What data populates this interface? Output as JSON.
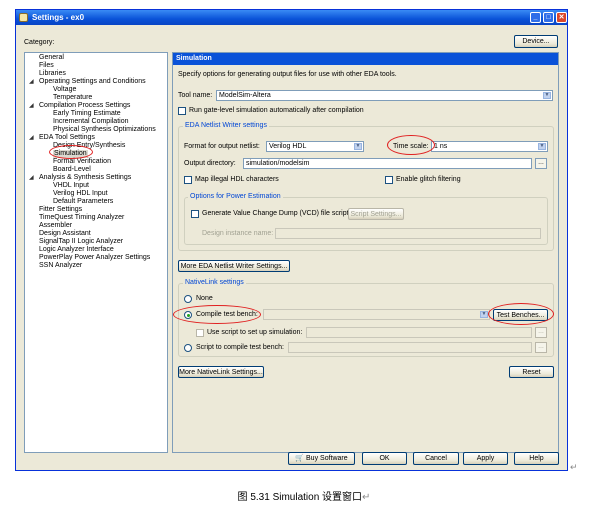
{
  "window": {
    "title": "Settings - ex0"
  },
  "category_label": "Category:",
  "device_button": "Device...",
  "tree": [
    {
      "label": "General"
    },
    {
      "label": "Files"
    },
    {
      "label": "Libraries"
    },
    {
      "label": "Operating Settings and Conditions",
      "expanded": true
    },
    {
      "label": "Voltage"
    },
    {
      "label": "Temperature"
    },
    {
      "label": "Compilation Process Settings",
      "expanded": true
    },
    {
      "label": "Early Timing Estimate"
    },
    {
      "label": "Incremental Compilation"
    },
    {
      "label": "Physical Synthesis Optimizations"
    },
    {
      "label": "EDA Tool Settings",
      "expanded": true
    },
    {
      "label": "Design Entry/Synthesis"
    },
    {
      "label": "Simulation",
      "selected": true
    },
    {
      "label": "Formal Verification"
    },
    {
      "label": "Board-Level"
    },
    {
      "label": "Analysis & Synthesis Settings",
      "expanded": true
    },
    {
      "label": "VHDL Input"
    },
    {
      "label": "Verilog HDL Input"
    },
    {
      "label": "Default Parameters"
    },
    {
      "label": "Fitter Settings"
    },
    {
      "label": "TimeQuest Timing Analyzer"
    },
    {
      "label": "Assembler"
    },
    {
      "label": "Design Assistant"
    },
    {
      "label": "SignalTap II Logic Analyzer"
    },
    {
      "label": "Logic Analyzer Interface"
    },
    {
      "label": "PowerPlay Power Analyzer Settings"
    },
    {
      "label": "SSN Analyzer"
    }
  ],
  "panel": {
    "header": "Simulation",
    "description": "Specify options for generating output files for use with other EDA tools.",
    "tool_name_label": "Tool name:",
    "tool_name_value": "ModelSim-Altera",
    "run_gate_level_label": "Run gate-level simulation automatically after compilation",
    "eda_netlist_group": {
      "title": "EDA Netlist Writer settings",
      "format_label": "Format for output netlist:",
      "format_value": "Verilog HDL",
      "time_scale_label": "Time scale:",
      "time_scale_value": "1 ns",
      "output_dir_label": "Output directory:",
      "output_dir_value": "simulation/modelsim",
      "map_illegal_label": "Map illegal HDL characters",
      "glitch_label": "Enable glitch filtering",
      "power_group": {
        "title": "Options for Power Estimation",
        "vcd_label": "Generate Value Change Dump (VCD) file script",
        "script_settings_button": "Script Settings...",
        "design_instance_label": "Design instance name:"
      }
    },
    "more_eda_button": "More EDA Netlist Writer Settings...",
    "nativelink_group": {
      "title": "NativeLink settings",
      "none_label": "None",
      "compile_tb_label": "Compile test bench:",
      "test_benches_button": "Test Benches...",
      "use_script_label": "Use script to set up simulation:",
      "script_compile_label": "Script to compile test bench:"
    },
    "more_nativelink_button": "More NativeLink Settings...",
    "reset_button": "Reset"
  },
  "footer": {
    "buy_software": "Buy Software",
    "ok": "OK",
    "cancel": "Cancel",
    "apply": "Apply",
    "help": "Help"
  },
  "caption": "图 5.31 Simulation 设置窗口"
}
